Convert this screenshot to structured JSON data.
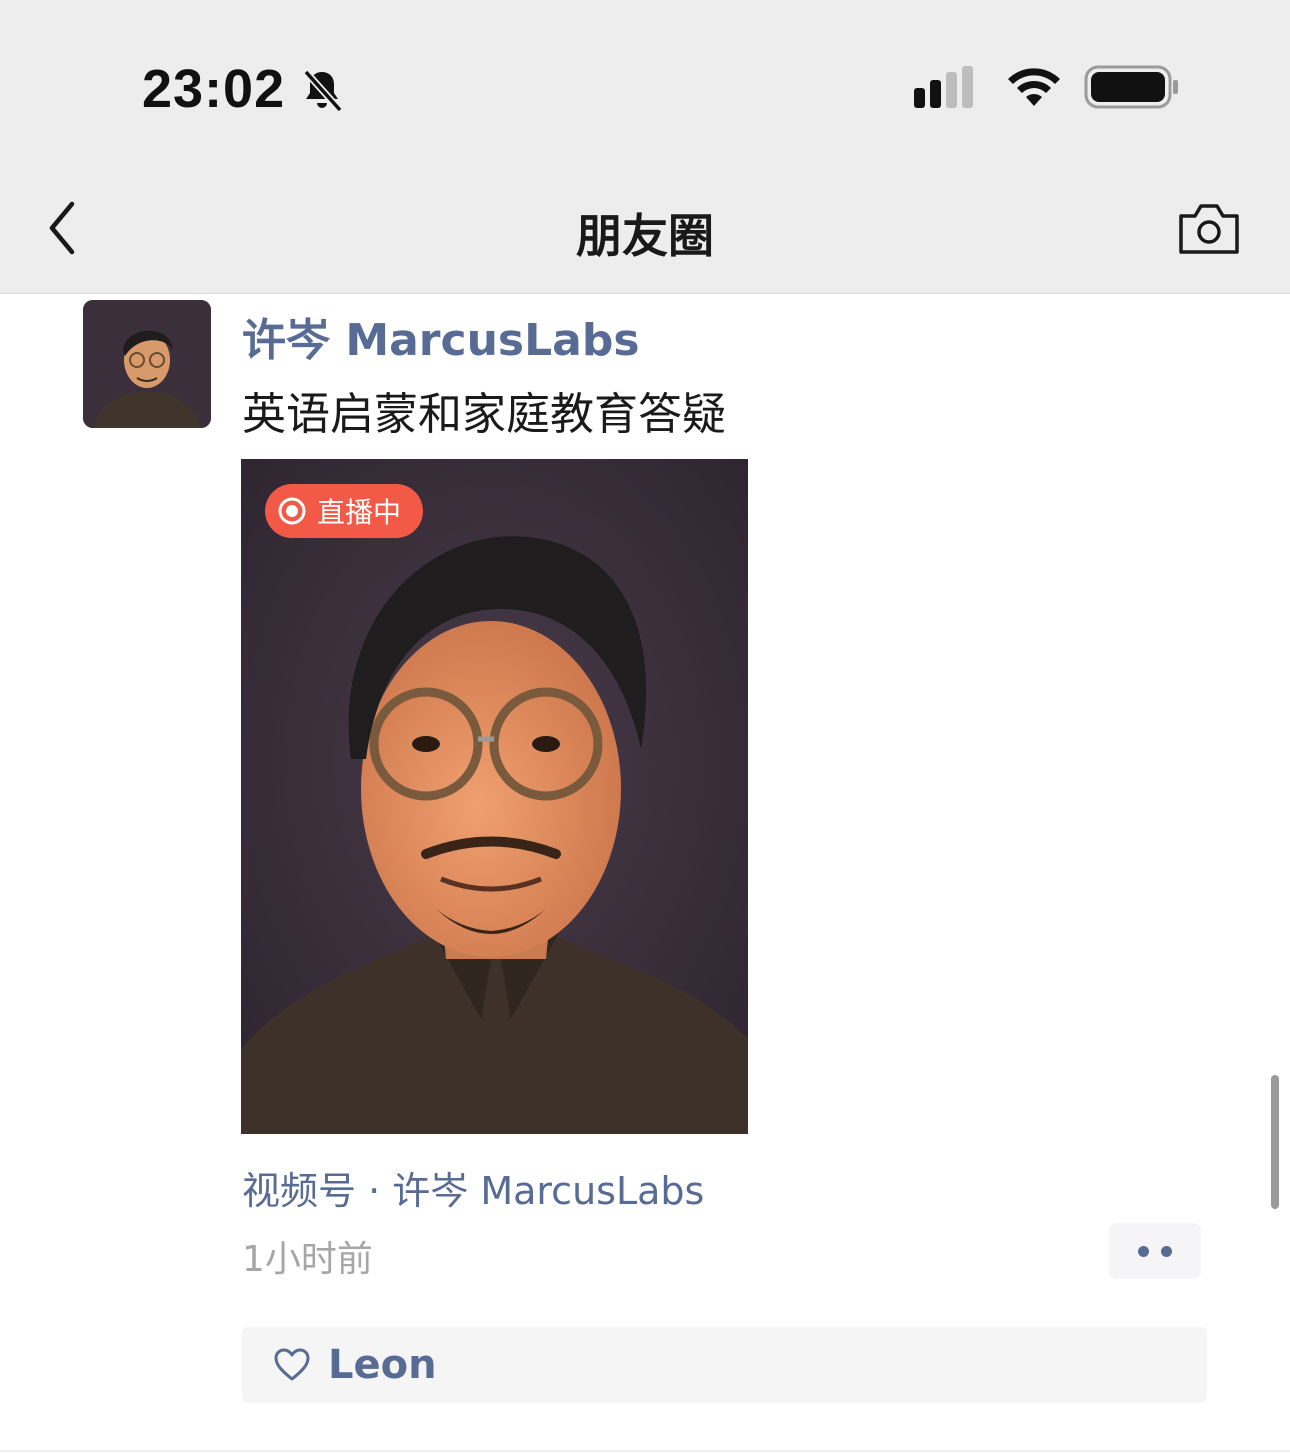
{
  "status_bar": {
    "time": "23:02",
    "icons": [
      "bell-muted-icon",
      "cellular-signal-icon",
      "wifi-icon",
      "battery-icon"
    ]
  },
  "nav": {
    "title": "朋友圈",
    "back_icon": "chevron-left-icon",
    "camera_icon": "camera-icon"
  },
  "post": {
    "author": "许岑 MarcusLabs",
    "text": "英语启蒙和家庭教育答疑",
    "live_badge": "直播中",
    "channel": "视频号 · 许岑 MarcusLabs",
    "time_ago": "1小时前",
    "likes": [
      "Leon"
    ]
  },
  "colors": {
    "link": "#576b95",
    "live_badge": "#f25a47",
    "nav_bg": "#ededed"
  }
}
